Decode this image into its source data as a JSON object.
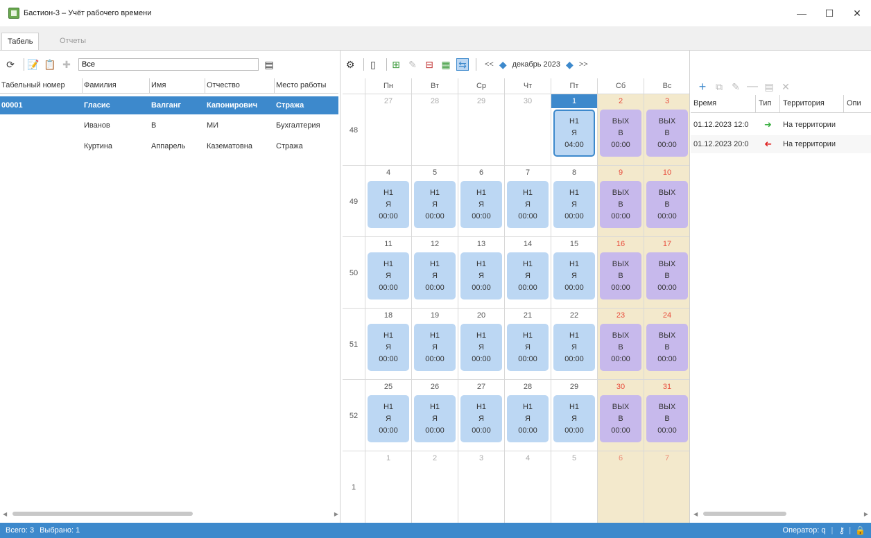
{
  "window": {
    "title": "Бастион-3 – Учёт рабочего времени",
    "min": "—",
    "max": "☐",
    "close": "✕"
  },
  "tabs": [
    {
      "label": "Табель"
    },
    {
      "label": "Отчеты"
    }
  ],
  "filter": {
    "value": "Все"
  },
  "employees": {
    "columns": [
      "Табельный номер",
      "Фамилия",
      "Имя",
      "Отчество",
      "Место работы"
    ],
    "rows": [
      [
        "00001",
        "Гласис",
        "Валганг",
        "Капонирович",
        "Стража"
      ],
      [
        "",
        "Иванов",
        "В",
        "МИ",
        "Бухгалтерия"
      ],
      [
        "",
        "Куртина",
        "Аппарель",
        "Казематовна",
        "Стража"
      ]
    ]
  },
  "calendar": {
    "month_label": "декабрь 2023",
    "nav_prev": "<<",
    "nav_next": ">>",
    "weekdays": [
      "Пн",
      "Вт",
      "Ср",
      "Чт",
      "Пт",
      "Сб",
      "Вс"
    ],
    "weeks": [
      {
        "num": "48",
        "days": [
          {
            "d": "27",
            "style": "gray"
          },
          {
            "d": "28",
            "style": "gray"
          },
          {
            "d": "29",
            "style": "gray"
          },
          {
            "d": "30",
            "style": "gray"
          },
          {
            "d": "1",
            "style": "today",
            "badge": [
              "Н1",
              "Я",
              "04:00"
            ],
            "kind": "today"
          },
          {
            "d": "2",
            "style": "red",
            "badge": [
              "ВЫХ",
              "В",
              "00:00"
            ],
            "kind": "off"
          },
          {
            "d": "3",
            "style": "red",
            "badge": [
              "ВЫХ",
              "В",
              "00:00"
            ],
            "kind": "off"
          }
        ]
      },
      {
        "num": "49",
        "days": [
          {
            "d": "4",
            "badge": [
              "Н1",
              "Я",
              "00:00"
            ],
            "kind": "work"
          },
          {
            "d": "5",
            "badge": [
              "Н1",
              "Я",
              "00:00"
            ],
            "kind": "work"
          },
          {
            "d": "6",
            "badge": [
              "Н1",
              "Я",
              "00:00"
            ],
            "kind": "work"
          },
          {
            "d": "7",
            "badge": [
              "Н1",
              "Я",
              "00:00"
            ],
            "kind": "work"
          },
          {
            "d": "8",
            "badge": [
              "Н1",
              "Я",
              "00:00"
            ],
            "kind": "work"
          },
          {
            "d": "9",
            "style": "red",
            "badge": [
              "ВЫХ",
              "В",
              "00:00"
            ],
            "kind": "off"
          },
          {
            "d": "10",
            "style": "red",
            "badge": [
              "ВЫХ",
              "В",
              "00:00"
            ],
            "kind": "off"
          }
        ]
      },
      {
        "num": "50",
        "days": [
          {
            "d": "11",
            "badge": [
              "Н1",
              "Я",
              "00:00"
            ],
            "kind": "work"
          },
          {
            "d": "12",
            "badge": [
              "Н1",
              "Я",
              "00:00"
            ],
            "kind": "work"
          },
          {
            "d": "13",
            "badge": [
              "Н1",
              "Я",
              "00:00"
            ],
            "kind": "work"
          },
          {
            "d": "14",
            "badge": [
              "Н1",
              "Я",
              "00:00"
            ],
            "kind": "work"
          },
          {
            "d": "15",
            "badge": [
              "Н1",
              "Я",
              "00:00"
            ],
            "kind": "work"
          },
          {
            "d": "16",
            "style": "red",
            "badge": [
              "ВЫХ",
              "В",
              "00:00"
            ],
            "kind": "off"
          },
          {
            "d": "17",
            "style": "red",
            "badge": [
              "ВЫХ",
              "В",
              "00:00"
            ],
            "kind": "off"
          }
        ]
      },
      {
        "num": "51",
        "days": [
          {
            "d": "18",
            "badge": [
              "Н1",
              "Я",
              "00:00"
            ],
            "kind": "work"
          },
          {
            "d": "19",
            "badge": [
              "Н1",
              "Я",
              "00:00"
            ],
            "kind": "work"
          },
          {
            "d": "20",
            "badge": [
              "Н1",
              "Я",
              "00:00"
            ],
            "kind": "work"
          },
          {
            "d": "21",
            "badge": [
              "Н1",
              "Я",
              "00:00"
            ],
            "kind": "work"
          },
          {
            "d": "22",
            "badge": [
              "Н1",
              "Я",
              "00:00"
            ],
            "kind": "work"
          },
          {
            "d": "23",
            "style": "red",
            "badge": [
              "ВЫХ",
              "В",
              "00:00"
            ],
            "kind": "off"
          },
          {
            "d": "24",
            "style": "red",
            "badge": [
              "ВЫХ",
              "В",
              "00:00"
            ],
            "kind": "off"
          }
        ]
      },
      {
        "num": "52",
        "days": [
          {
            "d": "25",
            "badge": [
              "Н1",
              "Я",
              "00:00"
            ],
            "kind": "work"
          },
          {
            "d": "26",
            "badge": [
              "Н1",
              "Я",
              "00:00"
            ],
            "kind": "work"
          },
          {
            "d": "27",
            "badge": [
              "Н1",
              "Я",
              "00:00"
            ],
            "kind": "work"
          },
          {
            "d": "28",
            "badge": [
              "Н1",
              "Я",
              "00:00"
            ],
            "kind": "work"
          },
          {
            "d": "29",
            "badge": [
              "Н1",
              "Я",
              "00:00"
            ],
            "kind": "work"
          },
          {
            "d": "30",
            "style": "red",
            "badge": [
              "ВЫХ",
              "В",
              "00:00"
            ],
            "kind": "off"
          },
          {
            "d": "31",
            "style": "red",
            "badge": [
              "ВЫХ",
              "В",
              "00:00"
            ],
            "kind": "off"
          }
        ]
      },
      {
        "num": "1",
        "days": [
          {
            "d": "1",
            "style": "gray"
          },
          {
            "d": "2",
            "style": "gray"
          },
          {
            "d": "3",
            "style": "gray"
          },
          {
            "d": "4",
            "style": "gray"
          },
          {
            "d": "5",
            "style": "gray"
          },
          {
            "d": "6",
            "style": "redgray"
          },
          {
            "d": "7",
            "style": "redgray"
          }
        ]
      }
    ]
  },
  "registrations": {
    "columns": [
      "Время",
      "Тип",
      "Территория",
      "Опи"
    ],
    "rows": [
      {
        "time": "01.12.2023 12:0",
        "type": "in",
        "territory": "На территории"
      },
      {
        "time": "01.12.2023 20:0",
        "type": "out",
        "territory": "На территории"
      }
    ]
  },
  "status": {
    "total": "Всего: 3",
    "selected": "Выбрано: 1",
    "operator": "Оператор: q"
  },
  "colors": {
    "accent": "#3d89cc",
    "work": "#bcd7f3",
    "off": "#c7b9ec",
    "weekend_bg": "#f3e9cc",
    "in_arrow": "#3cb043",
    "out_arrow": "#e02020"
  }
}
